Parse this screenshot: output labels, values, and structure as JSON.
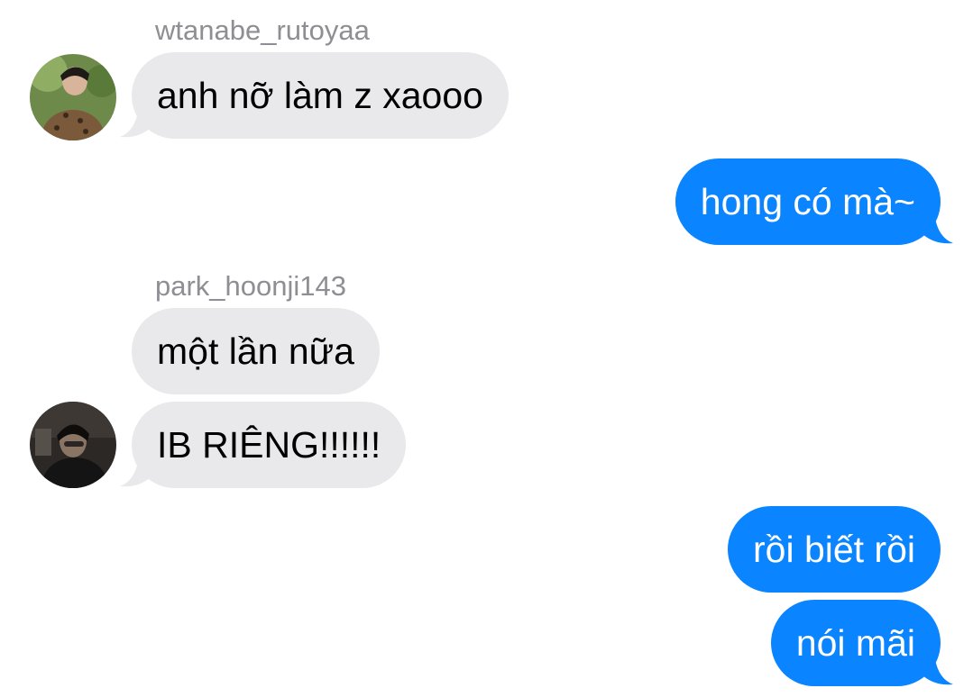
{
  "colors": {
    "incoming_bubble": "#e9e9eb",
    "outgoing_bubble": "#0a84ff",
    "sender_name": "#8e8e93"
  },
  "messages": [
    {
      "direction": "incoming",
      "sender": "wtanabe_rutoyaa",
      "text": "anh nỡ làm z xaooo",
      "avatar_icon": "user-avatar-photo"
    },
    {
      "direction": "outgoing",
      "text": "hong có mà~"
    },
    {
      "direction": "incoming",
      "sender": "park_hoonji143",
      "text": "một lần nữa"
    },
    {
      "direction": "incoming",
      "text": "IB RIÊNG!!!!!!",
      "avatar_icon": "user-avatar-photo"
    },
    {
      "direction": "outgoing",
      "text": "rồi biết rồi"
    },
    {
      "direction": "outgoing",
      "text": "nói mãi"
    }
  ]
}
